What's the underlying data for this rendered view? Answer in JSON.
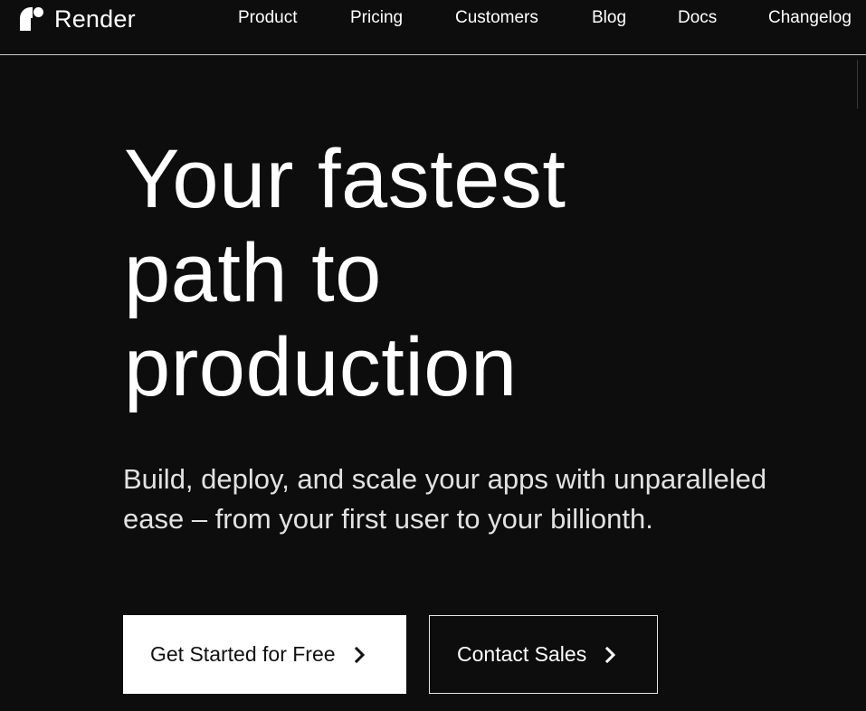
{
  "brand": {
    "name": "Render",
    "logo_icon": "render-logo-icon"
  },
  "nav": {
    "items": [
      {
        "label": "Product"
      },
      {
        "label": "Pricing"
      },
      {
        "label": "Customers"
      },
      {
        "label": "Blog"
      },
      {
        "label": "Docs"
      },
      {
        "label": "Changelog"
      }
    ]
  },
  "hero": {
    "title_lines": [
      "Your fastest",
      "path to",
      "production"
    ],
    "subtitle_lines": [
      "Build, deploy, and scale your apps with unparalleled",
      "ease – from your first user to your billionth."
    ]
  },
  "cta": {
    "primary_label": "Get Started for Free",
    "secondary_label": "Contact Sales",
    "arrow_icon": "chevron-right-icon"
  },
  "colors": {
    "background": "#0d0d0d",
    "text": "#ffffff",
    "primary_button_bg": "#ffffff",
    "primary_button_text": "#111111"
  }
}
